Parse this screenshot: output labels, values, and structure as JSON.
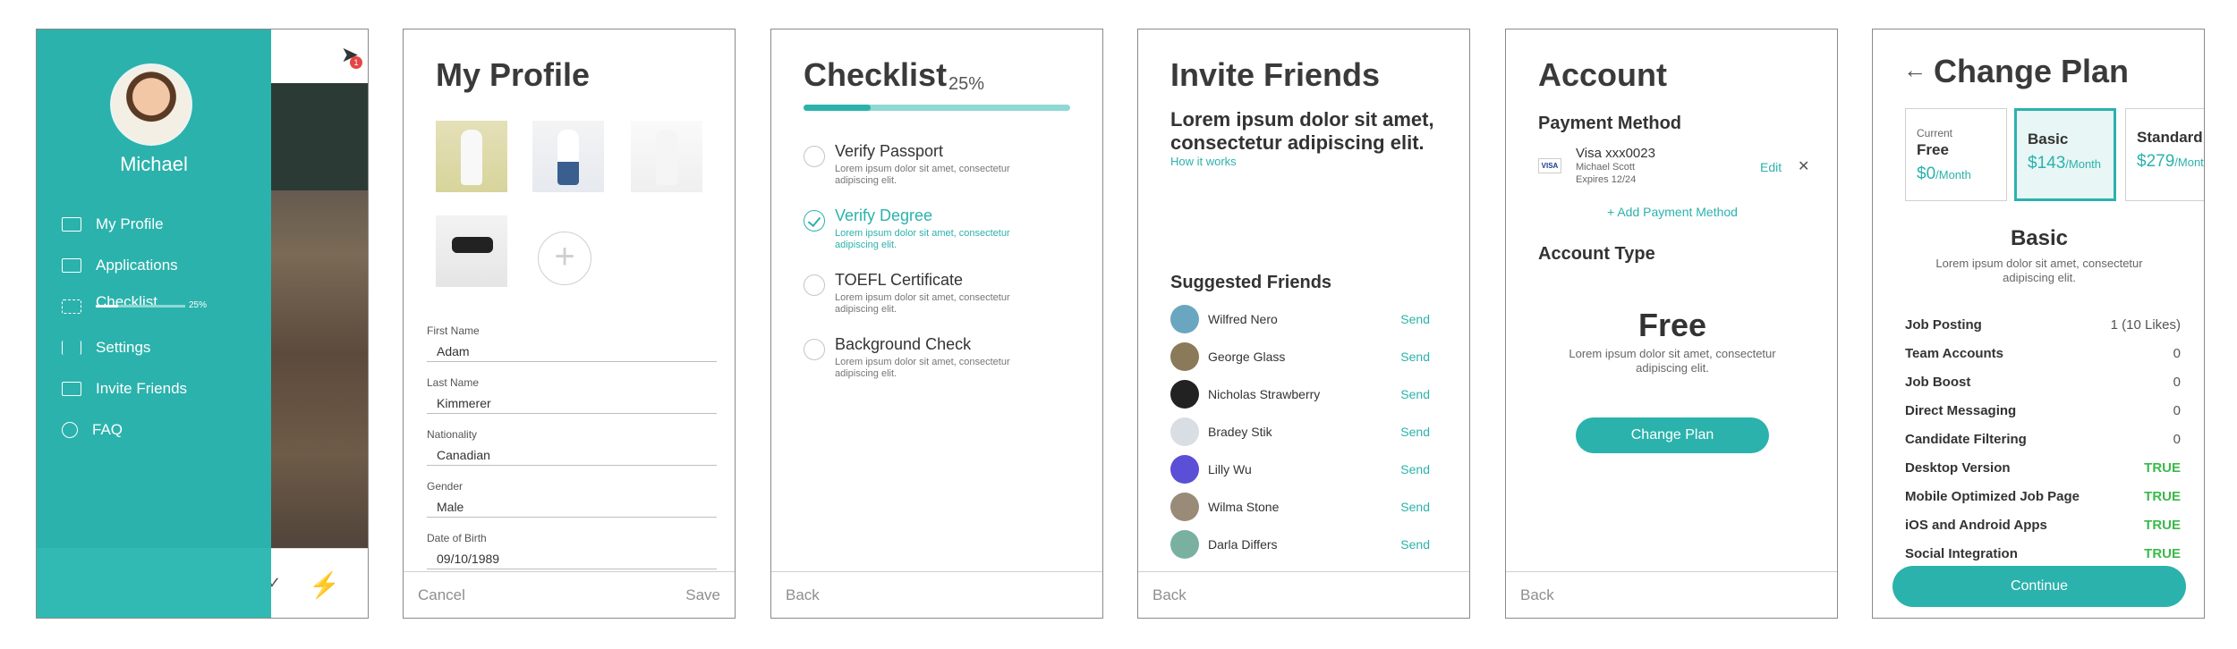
{
  "colors": {
    "accent": "#2bb2ac",
    "true_green": "#3bb94a"
  },
  "menu_screen": {
    "user_name": "Michael",
    "badge_count": "1",
    "items": [
      {
        "label": "My Profile",
        "icon": "id-card-icon"
      },
      {
        "label": "Applications",
        "icon": "document-icon"
      },
      {
        "label": "Checklist",
        "icon": "list-icon"
      },
      {
        "label": "Settings",
        "icon": "sliders-icon"
      },
      {
        "label": "Invite Friends",
        "icon": "gift-icon"
      },
      {
        "label": "FAQ",
        "icon": "lifebuoy-icon"
      }
    ],
    "checklist_progress_label": "25%",
    "checklist_progress": 0.25
  },
  "profile_screen": {
    "title": "My Profile",
    "fields": [
      {
        "label": "First Name",
        "value": "Adam"
      },
      {
        "label": "Last Name",
        "value": "Kimmerer"
      },
      {
        "label": "Nationality",
        "value": "Canadian"
      },
      {
        "label": "Gender",
        "value": "Male"
      },
      {
        "label": "Date of Birth",
        "value": "09/10/1989"
      }
    ],
    "cancel_label": "Cancel",
    "save_label": "Save"
  },
  "checklist_screen": {
    "title": "Checklist",
    "percent": "25%",
    "progress": 0.25,
    "items": [
      {
        "title": "Verify Passport",
        "desc": "Lorem ipsum dolor sit amet, consectetur adipiscing elit.",
        "done": false
      },
      {
        "title": "Verify Degree",
        "desc": "Lorem ipsum dolor sit amet, consectetur adipiscing elit.",
        "done": true
      },
      {
        "title": "TOEFL Certificate",
        "desc": "Lorem ipsum dolor sit amet, consectetur adipiscing elit.",
        "done": false
      },
      {
        "title": "Background Check",
        "desc": "Lorem ipsum dolor sit amet, consectetur adipiscing elit.",
        "done": false
      }
    ],
    "back_label": "Back"
  },
  "invite_screen": {
    "title": "Invite Friends",
    "intro": "Lorem ipsum dolor sit amet, consectetur adipiscing elit.",
    "how_it_works": "How it works",
    "suggested_title": "Suggested Friends",
    "send_label": "Send",
    "friends": [
      "Wilfred Nero",
      "George Glass",
      "Nicholas Strawberry",
      "Bradey Stik",
      "Lilly Wu",
      "Wilma Stone",
      "Darla Differs"
    ],
    "back_label": "Back"
  },
  "account_screen": {
    "title": "Account",
    "payment_title": "Payment Method",
    "card_brand": "VISA",
    "card_name": "Visa xxx0023",
    "card_holder": "Michael Scott",
    "card_expiry": "Expires 12/24",
    "edit_label": "Edit",
    "add_payment": "+ Add Payment Method",
    "account_type_title": "Account Type",
    "plan_name": "Free",
    "plan_desc": "Lorem ipsum dolor sit amet, consectetur adipiscing elit.",
    "change_plan_label": "Change Plan",
    "back_label": "Back"
  },
  "change_plan_screen": {
    "title": "Change Plan",
    "plans": [
      {
        "tag": "Current",
        "name": "Free",
        "price": "$0",
        "per": "/Month"
      },
      {
        "tag": "",
        "name": "Basic",
        "price": "$143",
        "per": "/Month"
      },
      {
        "tag": "",
        "name": "Standard",
        "price": "$279",
        "per": "/Month"
      }
    ],
    "selected_plan": "Basic",
    "selected_desc": "Lorem ipsum dolor sit amet, consectetur adipiscing elit.",
    "features": [
      {
        "name": "Job Posting",
        "value": "1 (10 Likes)"
      },
      {
        "name": "Team Accounts",
        "value": "0"
      },
      {
        "name": "Job Boost",
        "value": "0"
      },
      {
        "name": "Direct Messaging",
        "value": "0"
      },
      {
        "name": "Candidate Filtering",
        "value": "0"
      },
      {
        "name": "Desktop Version",
        "value": "TRUE"
      },
      {
        "name": "Mobile Optimized Job Page",
        "value": "TRUE"
      },
      {
        "name": "iOS and Android Apps",
        "value": "TRUE"
      },
      {
        "name": "Social Integration",
        "value": "TRUE"
      }
    ],
    "continue_label": "Continue"
  }
}
